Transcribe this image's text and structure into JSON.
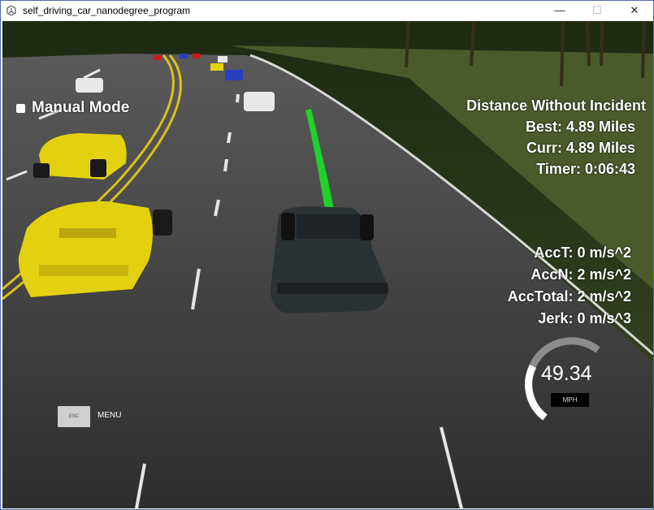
{
  "window": {
    "title": "self_driving_car_nanodegree_program"
  },
  "hud": {
    "mode": "Manual Mode",
    "distance_header": "Distance Without Incident",
    "best": "Best: 4.89 Miles",
    "curr": "Curr: 4.89 Miles",
    "timer": "Timer: 0:06:43",
    "acc_t": "AccT: 0 m/s^2",
    "acc_n": "AccN: 2 m/s^2",
    "acc_total": "AccTotal: 2 m/s^2",
    "jerk": "Jerk: 0 m/s^3"
  },
  "speedometer": {
    "value": "49.34",
    "unit": "MPH"
  },
  "menu": {
    "esc_label": "ESC",
    "menu_label": "MENU"
  },
  "colors": {
    "road": "#3a3a3a",
    "grass": "#3d4a22",
    "lane_yellow": "#d8c21a",
    "path_green": "#1fd12a",
    "ego_car": "#2b3236",
    "yellow_car": "#e3d10f",
    "white_car": "#e8e8e8",
    "blue_car": "#2a3fbf",
    "red_car": "#c51f1f"
  },
  "icons": [
    "unity-app-icon",
    "minimize-icon",
    "maximize-icon",
    "close-icon"
  ]
}
